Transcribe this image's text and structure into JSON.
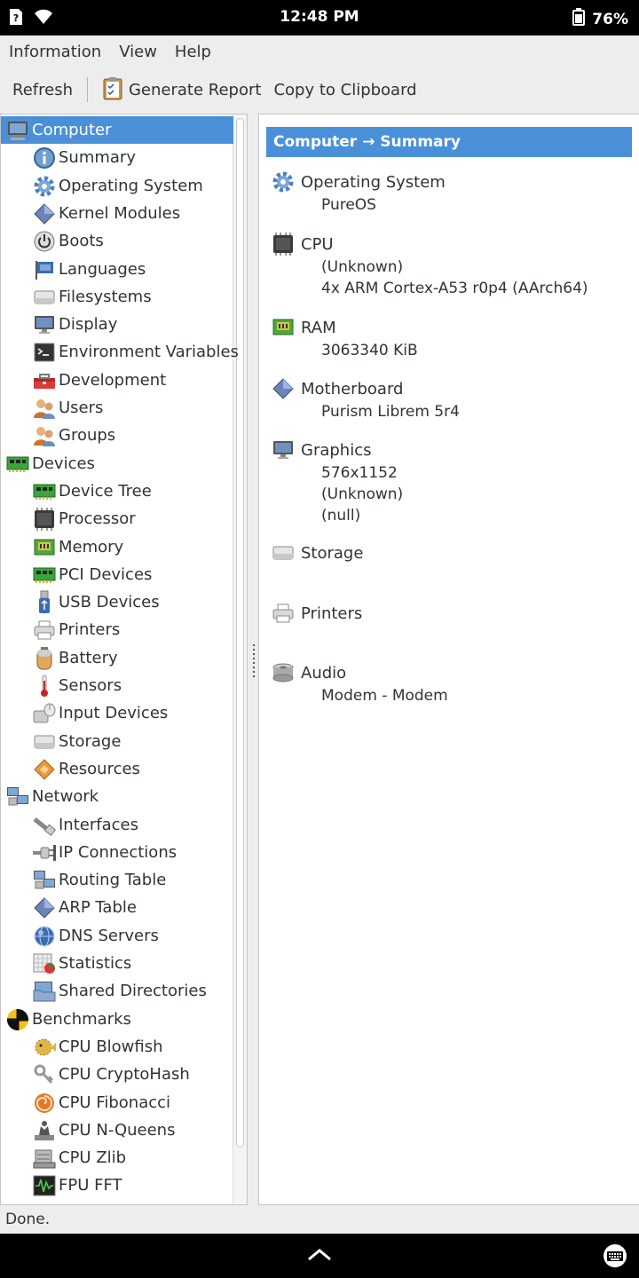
{
  "status_bar": {
    "time": "12:48 PM",
    "battery": "76%"
  },
  "menu": [
    "Information",
    "View",
    "Help"
  ],
  "toolbar": {
    "refresh": "Refresh",
    "generate_report": "Generate Report",
    "copy": "Copy to Clipboard"
  },
  "tree": [
    {
      "label": "Computer",
      "level": 0,
      "icon": "computer-icon",
      "selected": true
    },
    {
      "label": "Summary",
      "level": 1,
      "icon": "info-icon"
    },
    {
      "label": "Operating System",
      "level": 1,
      "icon": "gear-icon"
    },
    {
      "label": "Kernel Modules",
      "level": 1,
      "icon": "diamond-icon"
    },
    {
      "label": "Boots",
      "level": 1,
      "icon": "power-icon"
    },
    {
      "label": "Languages",
      "level": 1,
      "icon": "flag-icon"
    },
    {
      "label": "Filesystems",
      "level": 1,
      "icon": "drive-icon"
    },
    {
      "label": "Display",
      "level": 1,
      "icon": "monitor-icon"
    },
    {
      "label": "Environment Variables",
      "level": 1,
      "icon": "terminal-icon"
    },
    {
      "label": "Development",
      "level": 1,
      "icon": "toolbox-icon"
    },
    {
      "label": "Users",
      "level": 1,
      "icon": "users-icon"
    },
    {
      "label": "Groups",
      "level": 1,
      "icon": "users-icon"
    },
    {
      "label": "Devices",
      "level": 0,
      "icon": "board-icon"
    },
    {
      "label": "Device Tree",
      "level": 1,
      "icon": "board-icon"
    },
    {
      "label": "Processor",
      "level": 1,
      "icon": "chip-icon"
    },
    {
      "label": "Memory",
      "level": 1,
      "icon": "ram-icon"
    },
    {
      "label": "PCI Devices",
      "level": 1,
      "icon": "board-icon"
    },
    {
      "label": "USB Devices",
      "level": 1,
      "icon": "usb-icon"
    },
    {
      "label": "Printers",
      "level": 1,
      "icon": "printer-icon"
    },
    {
      "label": "Battery",
      "level": 1,
      "icon": "battery-icon"
    },
    {
      "label": "Sensors",
      "level": 1,
      "icon": "thermometer-icon"
    },
    {
      "label": "Input Devices",
      "level": 1,
      "icon": "input-icon"
    },
    {
      "label": "Storage",
      "level": 1,
      "icon": "drive-icon"
    },
    {
      "label": "Resources",
      "level": 1,
      "icon": "resources-icon"
    },
    {
      "label": "Network",
      "level": 0,
      "icon": "network-icon"
    },
    {
      "label": "Interfaces",
      "level": 1,
      "icon": "cable-icon"
    },
    {
      "label": "IP Connections",
      "level": 1,
      "icon": "plug-icon"
    },
    {
      "label": "Routing Table",
      "level": 1,
      "icon": "network-icon"
    },
    {
      "label": "ARP Table",
      "level": 1,
      "icon": "diamond-icon"
    },
    {
      "label": "DNS Servers",
      "level": 1,
      "icon": "globe-icon"
    },
    {
      "label": "Statistics",
      "level": 1,
      "icon": "chart-icon"
    },
    {
      "label": "Shared Directories",
      "level": 1,
      "icon": "folder-icon"
    },
    {
      "label": "Benchmarks",
      "level": 0,
      "icon": "benchmark-icon"
    },
    {
      "label": "CPU Blowfish",
      "level": 1,
      "icon": "blowfish-icon"
    },
    {
      "label": "CPU CryptoHash",
      "level": 1,
      "icon": "keys-icon"
    },
    {
      "label": "CPU Fibonacci",
      "level": 1,
      "icon": "shell-icon"
    },
    {
      "label": "CPU N-Queens",
      "level": 1,
      "icon": "queen-icon"
    },
    {
      "label": "CPU Zlib",
      "level": 1,
      "icon": "zlib-icon"
    },
    {
      "label": "FPU FFT",
      "level": 1,
      "icon": "fft-icon"
    }
  ],
  "panel": {
    "header": "Computer → Summary",
    "sections": [
      {
        "title": "Operating System",
        "icon": "gear-icon",
        "lines": [
          "PureOS"
        ]
      },
      {
        "title": "CPU",
        "icon": "chip-icon",
        "lines": [
          "(Unknown)",
          "4x ARM Cortex-A53 r0p4 (AArch64)"
        ]
      },
      {
        "title": "RAM",
        "icon": "ram-icon",
        "lines": [
          "3063340 KiB"
        ]
      },
      {
        "title": "Motherboard",
        "icon": "diamond-icon",
        "lines": [
          "Purism Librem 5r4"
        ]
      },
      {
        "title": "Graphics",
        "icon": "monitor-icon",
        "lines": [
          "576x1152",
          "(Unknown)",
          "(null)"
        ]
      },
      {
        "title": "Storage",
        "icon": "drive-icon",
        "lines": []
      },
      {
        "title": "Printers",
        "icon": "printer-icon",
        "lines": []
      },
      {
        "title": "Audio",
        "icon": "audio-icon",
        "lines": [
          "Modem - Modem"
        ]
      }
    ]
  },
  "status_text": "Done."
}
